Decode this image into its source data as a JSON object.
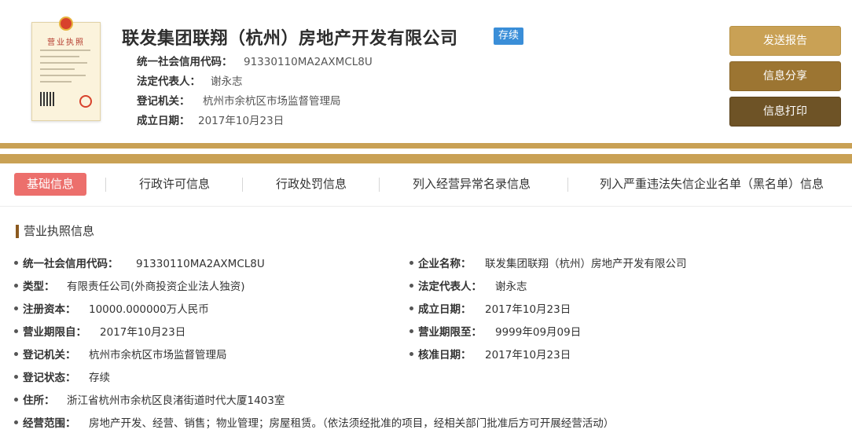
{
  "header": {
    "license_image_title": "营业执照",
    "company_name": "联发集团联翔（杭州）房地产开发有限公司",
    "status_tag": "存续",
    "rows": [
      {
        "key": "统一社会信用代码：",
        "value": "91330110MA2AXMCL8U"
      },
      {
        "key": "法定代表人：",
        "value": "谢永志"
      },
      {
        "key": "登记机关：",
        "value": "杭州市余杭区市场监督管理局"
      },
      {
        "key": "成立日期：",
        "value": "2017年10月23日"
      }
    ]
  },
  "buttons": {
    "report": "发送报告",
    "share": "信息分享",
    "print": "信息打印"
  },
  "tabs": [
    {
      "label": "基础信息",
      "active": true
    },
    {
      "label": "行政许可信息"
    },
    {
      "label": "行政处罚信息"
    },
    {
      "label": "列入经营异常名录信息"
    },
    {
      "label": "列入严重违法失信企业名单（黑名单）信息"
    }
  ],
  "section": {
    "title": "营业执照信息",
    "fields": [
      {
        "key": "统一社会信用代码：",
        "value": "91330110MA2AXMCL8U"
      },
      {
        "key": "企业名称：",
        "value": "联发集团联翔（杭州）房地产开发有限公司"
      },
      {
        "key": "类型：",
        "value": "有限责任公司(外商投资企业法人独资)"
      },
      {
        "key": "法定代表人：",
        "value": "谢永志"
      },
      {
        "key": "注册资本：",
        "value": "10000.000000万人民币"
      },
      {
        "key": "成立日期：",
        "value": "2017年10月23日"
      },
      {
        "key": "营业期限自：",
        "value": "2017年10月23日"
      },
      {
        "key": "营业期限至：",
        "value": "9999年09月09日"
      },
      {
        "key": "登记机关：",
        "value": "杭州市余杭区市场监督管理局"
      },
      {
        "key": "核准日期：",
        "value": "2017年10月23日"
      },
      {
        "key": "登记状态：",
        "value": "存续"
      },
      {
        "key": "住所：",
        "value": "浙江省杭州市余杭区良渚街道时代大厦1403室"
      },
      {
        "key": "经营范围：",
        "value": "房地产开发、经营、销售；物业管理；房屋租赁。（依法须经批准的项目，经相关部门批准后方可开展经营活动）"
      }
    ]
  },
  "colors": {
    "gold": "#c9a155",
    "brown": "#9c7532",
    "dark_brown": "#6e5326",
    "tab_active": "#ec6f6c",
    "status_blue": "#3a8ed8"
  }
}
